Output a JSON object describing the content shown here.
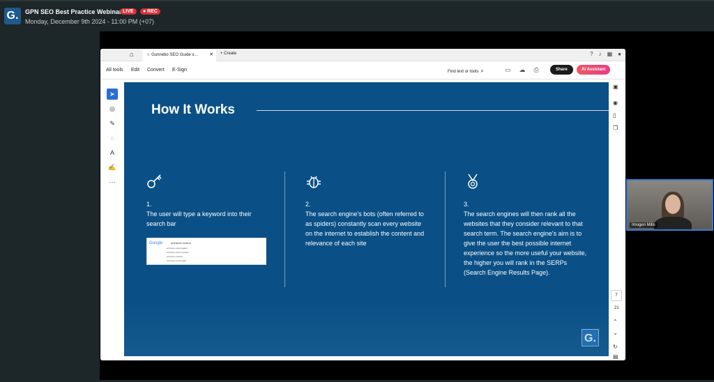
{
  "meeting": {
    "title": "GPN SEO Best Practice Webinar",
    "live_badge": "LIVE",
    "rec_badge": "● REC",
    "datetime": "Monday, December 9th 2024 - 11:00 PM (+07)",
    "logo_letter": "G."
  },
  "viewer": {
    "tab_title": "Gunnebo SEO Guide v...",
    "tab_close": "✕",
    "create_label": "+  Create",
    "menu": [
      "All tools",
      "Edit",
      "Convert",
      "E-Sign"
    ],
    "find_label": "Find text or tools",
    "share_label": "Share",
    "ai_label": "AI Assistant",
    "page_current": "7",
    "page_total": "21"
  },
  "slide": {
    "heading": "How It Works",
    "columns": [
      {
        "num": "1.",
        "text": "The user will type a keyword into their search bar",
        "icon": "key-icon"
      },
      {
        "num": "2.",
        "text": "The search engine's bots (often referred to as spiders) constantly scan every website on the internet to establish the content and relevance of each site",
        "icon": "bug-icon"
      },
      {
        "num": "3.",
        "text": "The search engines will then rank all the websites that they consider relevant to that search term. The search engine's aim is to give the user the best possible internet experience so the more useful your website, the higher you will rank in the SERPs (Search Engine Results Page).",
        "icon": "medal-icon"
      }
    ],
    "google_snapshot": {
      "logo": "Google",
      "query": "entrance control",
      "suggestions": [
        "entrance control gates",
        "entrance control system",
        "entrance controls",
        "entrance control gate"
      ]
    },
    "brand_letter": "G."
  },
  "webcam": {
    "participant_name": "Imogen Mills"
  }
}
